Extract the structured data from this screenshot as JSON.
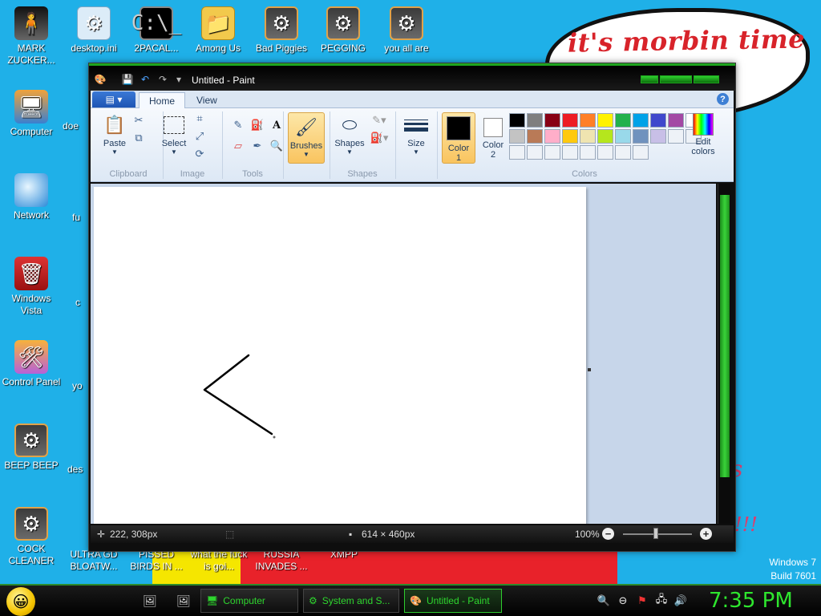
{
  "desktop": {
    "wallpaper_text": "it's morbin time",
    "wall_fragment_1": "s",
    "wall_fragment_2": "!!!",
    "watermark_line1": "Windows 7",
    "watermark_line2": "Build 7601",
    "icons_top": [
      {
        "label": "MARK ZUCKER..."
      },
      {
        "label": "desktop.ini"
      },
      {
        "label": "2PACAL..."
      },
      {
        "label": "Among Us"
      },
      {
        "label": "Bad Piggies"
      },
      {
        "label": "PEGGING"
      },
      {
        "label": "you all are"
      }
    ],
    "icons_left": [
      {
        "label": "Computer"
      },
      {
        "label": "Network"
      },
      {
        "label": "Windows Vista"
      },
      {
        "label": "Control Panel"
      },
      {
        "label": "BEEP BEEP"
      },
      {
        "label": "COCK CLEANER"
      }
    ],
    "icons_col2": [
      {
        "label": "doe"
      },
      {
        "label": "fu"
      },
      {
        "label": "c"
      },
      {
        "label": "yo"
      },
      {
        "label": "des"
      }
    ],
    "icons_bottom": [
      {
        "label": "ULTRA GD BLOATW..."
      },
      {
        "label": "PISSED BIRDS IN ..."
      },
      {
        "label": "what the fuck is goi..."
      },
      {
        "label": "RUSSIA INVADES ..."
      },
      {
        "label": "XMPP"
      }
    ]
  },
  "paint": {
    "title": "Untitled - Paint",
    "tabs": [
      "Home",
      "View"
    ],
    "groups": {
      "clipboard": "Clipboard",
      "image": "Image",
      "tools": "Tools",
      "shapes": "Shapes",
      "colors": "Colors"
    },
    "buttons": {
      "paste": "Paste",
      "select": "Select",
      "brushes": "Brushes",
      "shapes": "Shapes",
      "size": "Size",
      "color1_line1": "Color",
      "color1_line2": "1",
      "color2_line1": "Color",
      "color2_line2": "2",
      "edit_colors_line1": "Edit",
      "edit_colors_line2": "colors"
    },
    "color1": "#000000",
    "color2": "#ffffff",
    "palette": [
      "#000000",
      "#7f7f7f",
      "#880015",
      "#ed1c24",
      "#ff7f27",
      "#fff200",
      "#22b14c",
      "#00a2e8",
      "#3f48cc",
      "#a349a4",
      "#ffffff",
      "#c3c3c3",
      "#b97a57",
      "#ffaec9",
      "#ffc90e",
      "#efe4b0",
      "#b5e61d",
      "#99d9ea",
      "#7092be",
      "#c8bfe7",
      "#eef2f7",
      "#eef2f7",
      "#eef2f7",
      "#eef2f7",
      "#eef2f7",
      "#eef2f7",
      "#eef2f7",
      "#eef2f7",
      "#eef2f7",
      "#eef2f7"
    ],
    "status": {
      "cursor_pos": "222, 308px",
      "canvas_size": "614 × 460px",
      "zoom": "100%"
    }
  },
  "taskbar": {
    "buttons": [
      {
        "label": "Computer"
      },
      {
        "label": "System and S..."
      },
      {
        "label": "Untitled - Paint"
      }
    ],
    "clock": "7:35 PM"
  }
}
